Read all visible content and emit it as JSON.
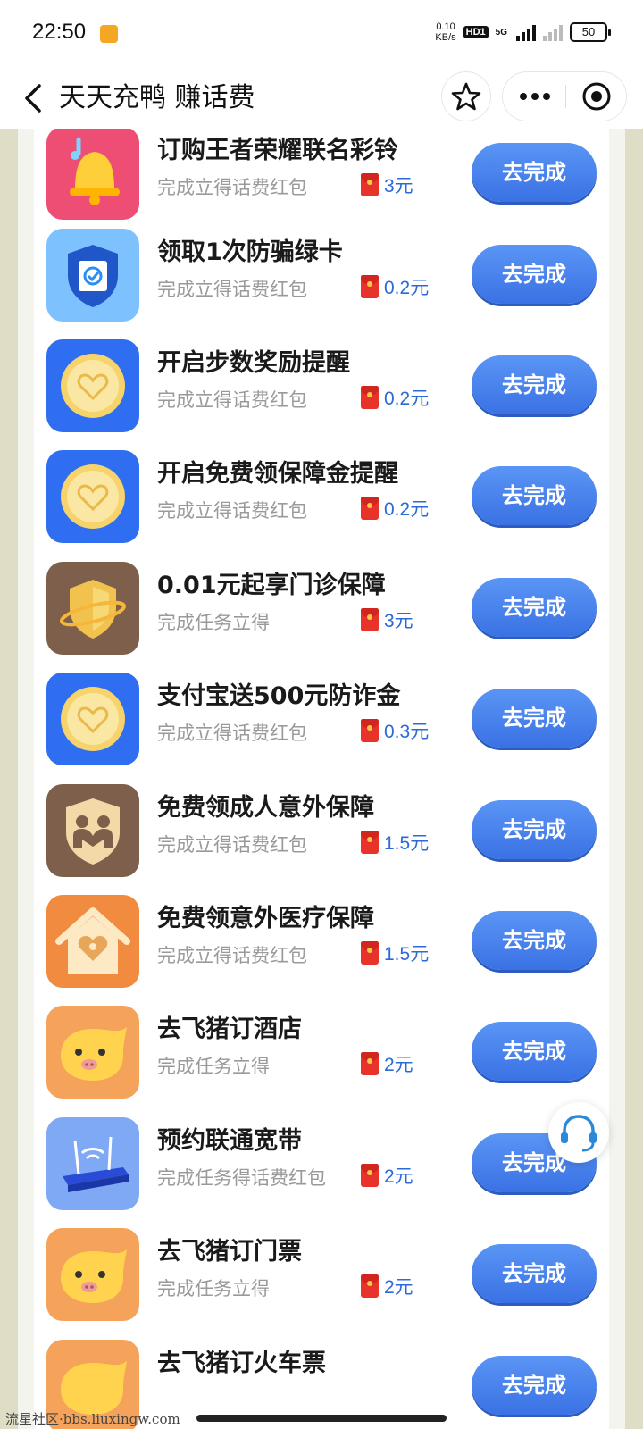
{
  "status_bar": {
    "time": "22:50",
    "speed_value": "0.10",
    "speed_unit": "KB/s",
    "hd_badge": "HD1",
    "network": "5G",
    "battery": "50"
  },
  "nav": {
    "title": "天天充鸭 赚话费",
    "icons": [
      "back-icon",
      "star-icon",
      "more-icon",
      "target-icon"
    ]
  },
  "tasks": [
    {
      "title": "订购王者荣耀联名彩铃",
      "subtitle": "完成立得话费红包",
      "reward": "3元",
      "button": "去完成",
      "icon": "bell-icon",
      "icon_color": "#ee4d74"
    },
    {
      "title": "领取1次防骗绿卡",
      "subtitle": "完成立得话费红包",
      "reward": "0.2元",
      "button": "去完成",
      "icon": "shield-check-icon",
      "icon_color": "#7ec1ff"
    },
    {
      "title": "开启步数奖励提醒",
      "subtitle": "完成立得话费红包",
      "reward": "0.2元",
      "button": "去完成",
      "icon": "coin-heart-icon",
      "icon_color": "#2f6ef0"
    },
    {
      "title": "开启免费领保障金提醒",
      "subtitle": "完成立得话费红包",
      "reward": "0.2元",
      "button": "去完成",
      "icon": "coin-heart-icon",
      "icon_color": "#2f6ef0"
    },
    {
      "title": "0.01元起享门诊保障",
      "subtitle": "完成任务立得",
      "reward": "3元",
      "button": "去完成",
      "icon": "gold-shield-icon",
      "icon_color": "#7e5f4c"
    },
    {
      "title": "支付宝送500元防诈金",
      "subtitle": "完成立得话费红包",
      "reward": "0.3元",
      "button": "去完成",
      "icon": "coin-heart-icon",
      "icon_color": "#2f6ef0"
    },
    {
      "title": "免费领成人意外保障",
      "subtitle": "完成立得话费红包",
      "reward": "1.5元",
      "button": "去完成",
      "icon": "family-shield-icon",
      "icon_color": "#7e5f4c"
    },
    {
      "title": "免费领意外医疗保障",
      "subtitle": "完成立得话费红包",
      "reward": "1.5元",
      "button": "去完成",
      "icon": "house-heart-icon",
      "icon_color": "#f08b3f"
    },
    {
      "title": "去飞猪订酒店",
      "subtitle": "完成任务立得",
      "reward": "2元",
      "button": "去完成",
      "icon": "fliggy-pig-icon",
      "icon_color": "#f5a25a"
    },
    {
      "title": "预约联通宽带",
      "subtitle": "完成任务得话费红包",
      "reward": "2元",
      "button": "去完成",
      "icon": "wifi-router-icon",
      "icon_color": "#7fa9f5"
    },
    {
      "title": "去飞猪订门票",
      "subtitle": "完成任务立得",
      "reward": "2元",
      "button": "去完成",
      "icon": "fliggy-pig-icon",
      "icon_color": "#f5a25a"
    },
    {
      "title": "去飞猪订火车票",
      "subtitle": "",
      "reward": "",
      "button": "去完成",
      "icon": "fliggy-pig-icon",
      "icon_color": "#f5a25a"
    }
  ],
  "watermark": "流星社区·bbs.liuxingw.com",
  "colors": {
    "button_blue": "#3a72e4",
    "reward_blue": "#2b6ad8",
    "red_packet": "#e8332b",
    "side_bg": "#dfddc5"
  }
}
